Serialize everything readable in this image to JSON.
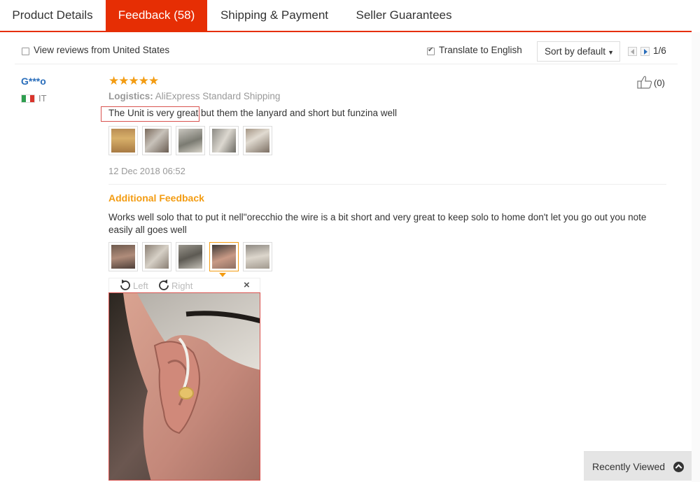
{
  "tabs": [
    {
      "label": "Product Details"
    },
    {
      "label": "Feedback (58)"
    },
    {
      "label": "Shipping & Payment"
    },
    {
      "label": "Seller Guarantees"
    }
  ],
  "filters": {
    "us_only_label": "View reviews from United States",
    "translate_label": "Translate to English",
    "sort_label": "Sort by default",
    "page_indicator": "1/6"
  },
  "review": {
    "user": "G***o",
    "country": "IT",
    "rating_stars": "★★★★★",
    "logistics_label": "Logistics:",
    "logistics_value": "AliExpress Standard Shipping",
    "text": "The Unit is very great but them the lanyard and short but funzina well",
    "date": "12 Dec 2018 06:52",
    "helpful_count": "(0)",
    "additional_title": "Additional Feedback",
    "additional_text": "Works well solo that to put it nell''orecchio the wire is a bit short and very great to keep solo to home don't let you go out you note easily all goes well"
  },
  "viewer": {
    "rotate_left": "Left",
    "rotate_right": "Right",
    "close": "×"
  },
  "recently_viewed": "Recently Viewed",
  "colors": {
    "accent": "#e62e04",
    "star": "#f39c12",
    "link": "#2a6ebb"
  }
}
